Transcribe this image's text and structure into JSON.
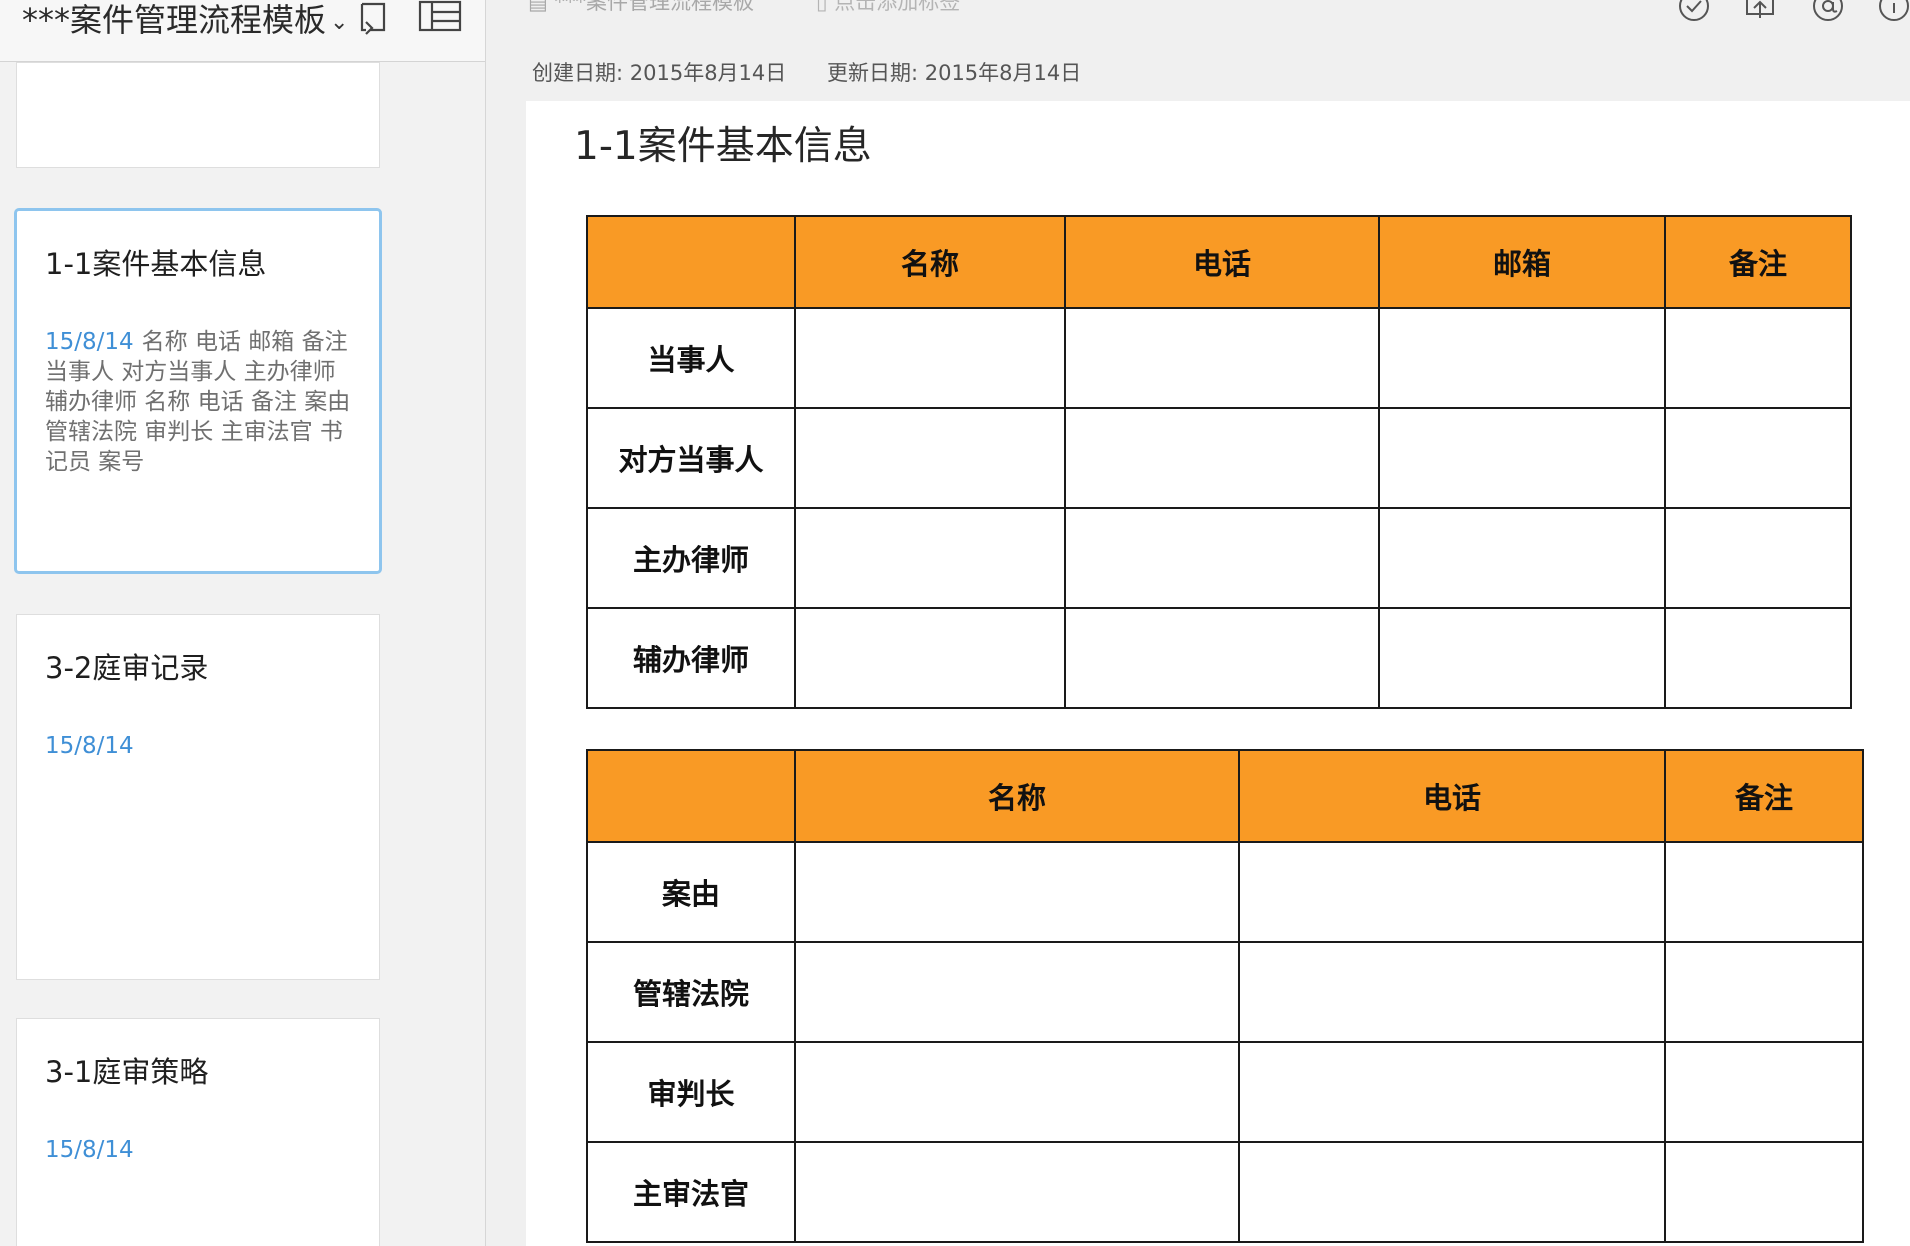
{
  "sidebar": {
    "notebook_title": "***案件管理流程模板",
    "notes": [
      {
        "title": "1-1案件基本信息",
        "date": "15/8/14",
        "snippet": "名称 电话 邮箱 备注 当事人 对方当事人 主办律师 辅办律师 名称 电话 备注 案由 管辖法院 审判长 主审法官 书记员 案号"
      },
      {
        "title": "3-2庭审记录",
        "date": "15/8/14",
        "snippet": ""
      },
      {
        "title": "3-1庭审策略",
        "date": "15/8/14",
        "snippet": ""
      }
    ]
  },
  "toolbar": {
    "notebook_label": "***案件管理流程模板",
    "tags_placeholder": "点击添加标签",
    "icons": [
      "checkmark-icon",
      "share-icon",
      "at-icon",
      "info-icon"
    ]
  },
  "meta": {
    "created": "创建日期: 2015年8月14日",
    "updated": "更新日期: 2015年8月14日"
  },
  "note": {
    "title": "1-1案件基本信息",
    "table1": {
      "headers": [
        "",
        "名称",
        "电话",
        "邮箱",
        "备注"
      ],
      "rows": [
        [
          "当事人",
          "",
          "",
          "",
          ""
        ],
        [
          "对方当事人",
          "",
          "",
          "",
          ""
        ],
        [
          "主办律师",
          "",
          "",
          "",
          ""
        ],
        [
          "辅办律师",
          "",
          "",
          "",
          ""
        ]
      ]
    },
    "table2": {
      "headers": [
        "",
        "名称",
        "电话",
        "备注"
      ],
      "rows": [
        [
          "案由",
          "",
          "",
          ""
        ],
        [
          "管辖法院",
          "",
          "",
          ""
        ],
        [
          "审判长",
          "",
          "",
          ""
        ],
        [
          "主审法官",
          "",
          "",
          ""
        ]
      ]
    }
  },
  "colors": {
    "header_orange": "#f99a25",
    "date_blue": "#3f8fd6",
    "selected_border": "#8ec5ee"
  }
}
